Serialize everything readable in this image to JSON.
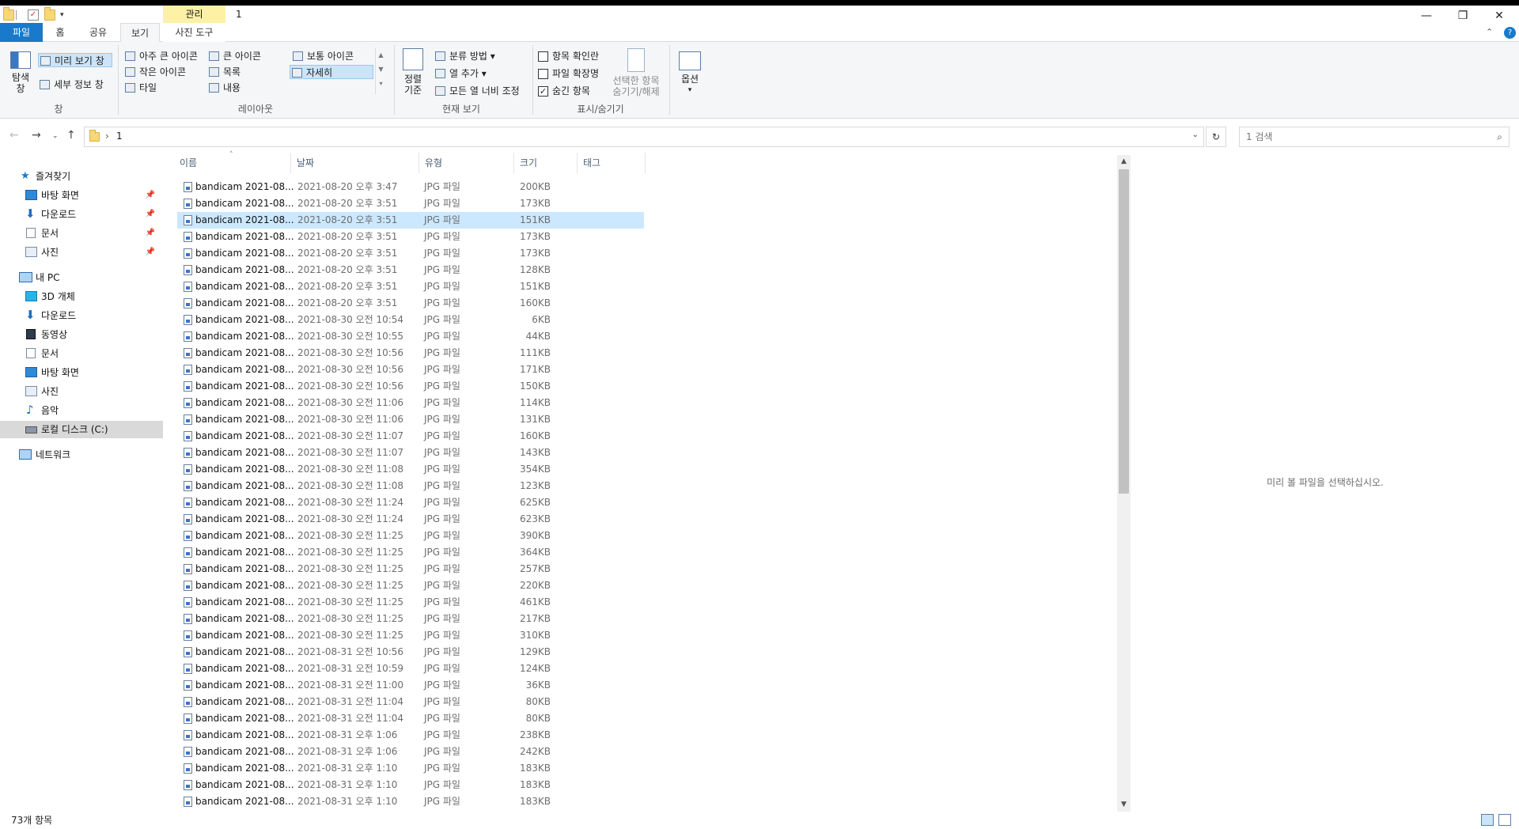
{
  "window": {
    "title": "1",
    "context_tab_header": "관리",
    "min": "—",
    "max": "❐",
    "close": "✕"
  },
  "ribbon_tabs": {
    "file": "파일",
    "home": "홈",
    "share": "공유",
    "view": "보기",
    "picture_tools": "사진 도구"
  },
  "ribbon": {
    "pane_group": {
      "nav_pane": "탐색\n창",
      "preview_pane": "미리 보기 창",
      "details_pane": "세부 정보 창",
      "label": "창"
    },
    "layout_group": {
      "extra_large": "아주 큰 아이콘",
      "large": "큰 아이콘",
      "medium": "보통 아이콘",
      "small": "작은 아이콘",
      "list": "목록",
      "details": "자세히",
      "tiles": "타일",
      "content": "내용",
      "label": "레이아웃"
    },
    "current_view_group": {
      "sort_by": "정렬",
      "sort_by_line2": "기준",
      "group_by": "분류 방법",
      "add_columns": "열 추가",
      "fit_columns": "모든 열 너비 조정",
      "label": "현재 보기"
    },
    "show_hide_group": {
      "item_checkboxes": "항목 확인란",
      "file_extensions": "파일 확장명",
      "hidden_items": "숨긴 항목",
      "hide_selected_1": "선택한 항목",
      "hide_selected_2": "숨기기/해제",
      "label": "표시/숨기기"
    },
    "options": "옵션"
  },
  "address": {
    "path": "1",
    "search_placeholder": "1 검색",
    "refresh": "↻"
  },
  "nav_pane": {
    "quick_access": "즐겨찾기",
    "qa_items": [
      "바탕 화면",
      "다운로드",
      "문서",
      "사진"
    ],
    "this_pc": "내 PC",
    "pc_items": [
      "3D 개체",
      "다운로드",
      "동영상",
      "문서",
      "바탕 화면",
      "사진",
      "음악",
      "로컬 디스크 (C:)"
    ],
    "network": "네트워크"
  },
  "columns": {
    "name": "이름",
    "date": "날짜",
    "type": "유형",
    "size": "크기",
    "tags": "태그"
  },
  "files": [
    {
      "name": "bandicam 2021-08...",
      "date": "2021-08-20 오후 3:47",
      "type": "JPG 파일",
      "size": "200KB"
    },
    {
      "name": "bandicam 2021-08...",
      "date": "2021-08-20 오후 3:51",
      "type": "JPG 파일",
      "size": "173KB"
    },
    {
      "name": "bandicam 2021-08...",
      "date": "2021-08-20 오후 3:51",
      "type": "JPG 파일",
      "size": "151KB"
    },
    {
      "name": "bandicam 2021-08...",
      "date": "2021-08-20 오후 3:51",
      "type": "JPG 파일",
      "size": "173KB"
    },
    {
      "name": "bandicam 2021-08...",
      "date": "2021-08-20 오후 3:51",
      "type": "JPG 파일",
      "size": "173KB"
    },
    {
      "name": "bandicam 2021-08...",
      "date": "2021-08-20 오후 3:51",
      "type": "JPG 파일",
      "size": "128KB"
    },
    {
      "name": "bandicam 2021-08...",
      "date": "2021-08-20 오후 3:51",
      "type": "JPG 파일",
      "size": "151KB"
    },
    {
      "name": "bandicam 2021-08...",
      "date": "2021-08-20 오후 3:51",
      "type": "JPG 파일",
      "size": "160KB"
    },
    {
      "name": "bandicam 2021-08...",
      "date": "2021-08-30 오전 10:54",
      "type": "JPG 파일",
      "size": "6KB"
    },
    {
      "name": "bandicam 2021-08...",
      "date": "2021-08-30 오전 10:55",
      "type": "JPG 파일",
      "size": "44KB"
    },
    {
      "name": "bandicam 2021-08...",
      "date": "2021-08-30 오전 10:56",
      "type": "JPG 파일",
      "size": "111KB"
    },
    {
      "name": "bandicam 2021-08...",
      "date": "2021-08-30 오전 10:56",
      "type": "JPG 파일",
      "size": "171KB"
    },
    {
      "name": "bandicam 2021-08...",
      "date": "2021-08-30 오전 10:56",
      "type": "JPG 파일",
      "size": "150KB"
    },
    {
      "name": "bandicam 2021-08...",
      "date": "2021-08-30 오전 11:06",
      "type": "JPG 파일",
      "size": "114KB"
    },
    {
      "name": "bandicam 2021-08...",
      "date": "2021-08-30 오전 11:06",
      "type": "JPG 파일",
      "size": "131KB"
    },
    {
      "name": "bandicam 2021-08...",
      "date": "2021-08-30 오전 11:07",
      "type": "JPG 파일",
      "size": "160KB"
    },
    {
      "name": "bandicam 2021-08...",
      "date": "2021-08-30 오전 11:07",
      "type": "JPG 파일",
      "size": "143KB"
    },
    {
      "name": "bandicam 2021-08...",
      "date": "2021-08-30 오전 11:08",
      "type": "JPG 파일",
      "size": "354KB"
    },
    {
      "name": "bandicam 2021-08...",
      "date": "2021-08-30 오전 11:08",
      "type": "JPG 파일",
      "size": "123KB"
    },
    {
      "name": "bandicam 2021-08...",
      "date": "2021-08-30 오전 11:24",
      "type": "JPG 파일",
      "size": "625KB"
    },
    {
      "name": "bandicam 2021-08...",
      "date": "2021-08-30 오전 11:24",
      "type": "JPG 파일",
      "size": "623KB"
    },
    {
      "name": "bandicam 2021-08...",
      "date": "2021-08-30 오전 11:25",
      "type": "JPG 파일",
      "size": "390KB"
    },
    {
      "name": "bandicam 2021-08...",
      "date": "2021-08-30 오전 11:25",
      "type": "JPG 파일",
      "size": "364KB"
    },
    {
      "name": "bandicam 2021-08...",
      "date": "2021-08-30 오전 11:25",
      "type": "JPG 파일",
      "size": "257KB"
    },
    {
      "name": "bandicam 2021-08...",
      "date": "2021-08-30 오전 11:25",
      "type": "JPG 파일",
      "size": "220KB"
    },
    {
      "name": "bandicam 2021-08...",
      "date": "2021-08-30 오전 11:25",
      "type": "JPG 파일",
      "size": "461KB"
    },
    {
      "name": "bandicam 2021-08...",
      "date": "2021-08-30 오전 11:25",
      "type": "JPG 파일",
      "size": "217KB"
    },
    {
      "name": "bandicam 2021-08...",
      "date": "2021-08-30 오전 11:25",
      "type": "JPG 파일",
      "size": "310KB"
    },
    {
      "name": "bandicam 2021-08...",
      "date": "2021-08-31 오전 10:56",
      "type": "JPG 파일",
      "size": "129KB"
    },
    {
      "name": "bandicam 2021-08...",
      "date": "2021-08-31 오전 10:59",
      "type": "JPG 파일",
      "size": "124KB"
    },
    {
      "name": "bandicam 2021-08...",
      "date": "2021-08-31 오전 11:00",
      "type": "JPG 파일",
      "size": "36KB"
    },
    {
      "name": "bandicam 2021-08...",
      "date": "2021-08-31 오전 11:04",
      "type": "JPG 파일",
      "size": "80KB"
    },
    {
      "name": "bandicam 2021-08...",
      "date": "2021-08-31 오전 11:04",
      "type": "JPG 파일",
      "size": "80KB"
    },
    {
      "name": "bandicam 2021-08...",
      "date": "2021-08-31 오후 1:06",
      "type": "JPG 파일",
      "size": "238KB"
    },
    {
      "name": "bandicam 2021-08...",
      "date": "2021-08-31 오후 1:06",
      "type": "JPG 파일",
      "size": "242KB"
    },
    {
      "name": "bandicam 2021-08...",
      "date": "2021-08-31 오후 1:10",
      "type": "JPG 파일",
      "size": "183KB"
    },
    {
      "name": "bandicam 2021-08...",
      "date": "2021-08-31 오후 1:10",
      "type": "JPG 파일",
      "size": "183KB"
    },
    {
      "name": "bandicam 2021-08...",
      "date": "2021-08-31 오후 1:10",
      "type": "JPG 파일",
      "size": "183KB"
    }
  ],
  "selected_row": 2,
  "preview_message": "미리 볼 파일을 선택하십시오.",
  "status": {
    "item_count": "73개 항목"
  },
  "colors": {
    "accent": "#1979ca",
    "selection": "#cce8ff",
    "context_tab": "#fdf1a6"
  }
}
